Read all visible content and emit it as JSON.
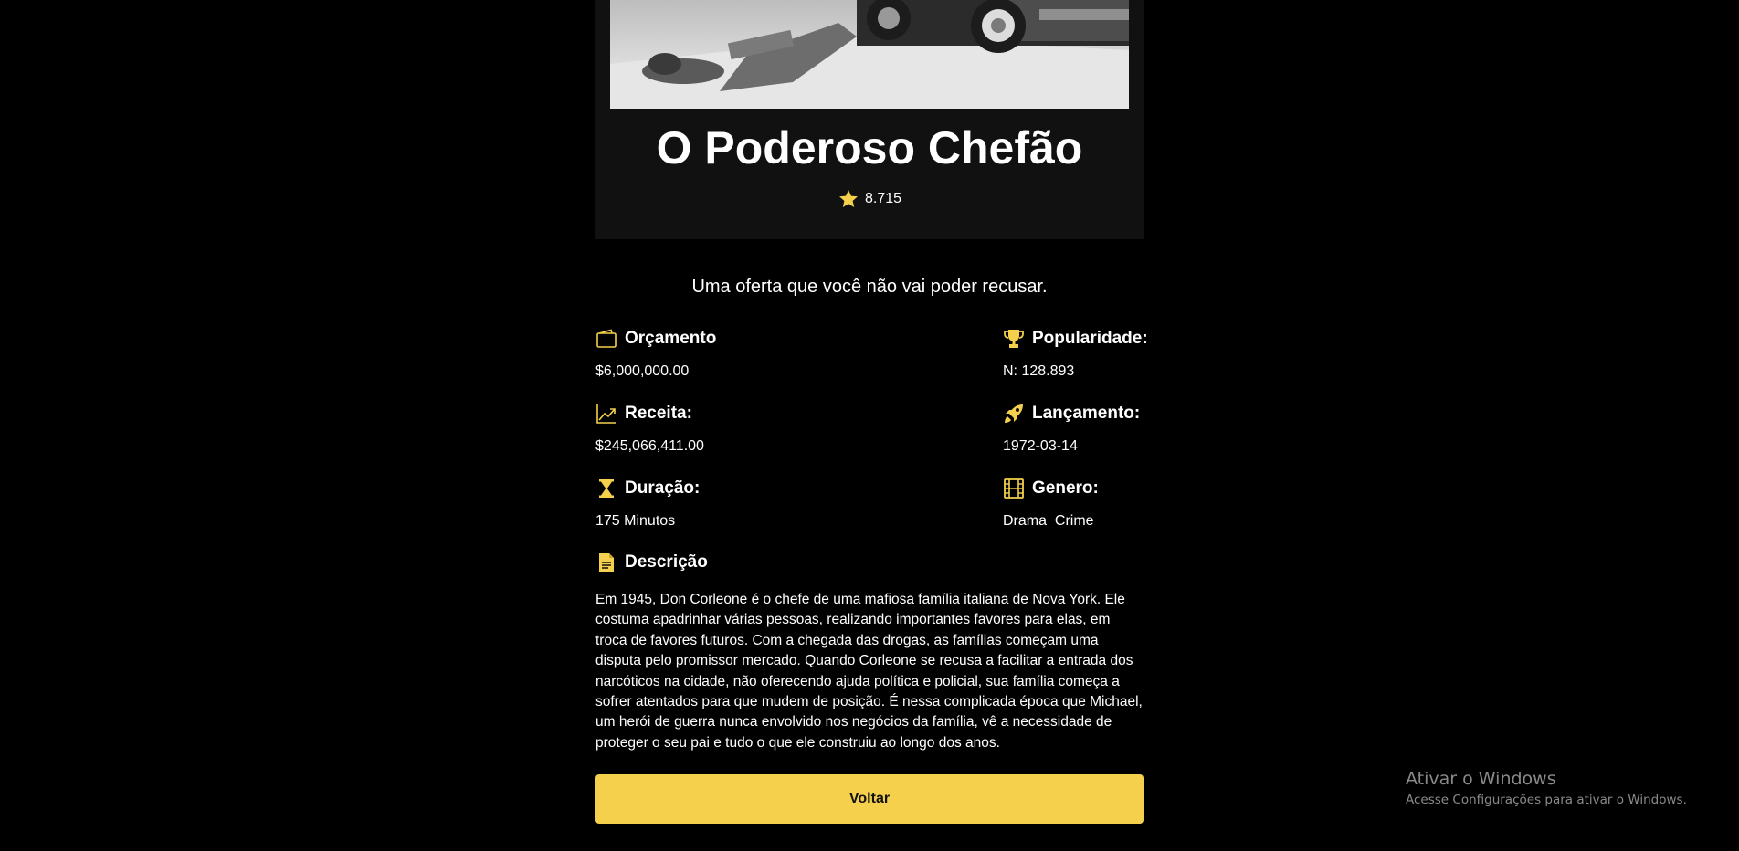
{
  "movie": {
    "title": "O Poderoso Chefão",
    "rating": "8.715",
    "tagline": "Uma oferta que você não vai poder recusar."
  },
  "details": {
    "budget": {
      "label": "Orçamento",
      "value": "$6,000,000.00",
      "icon": "wallet-icon"
    },
    "popularity": {
      "label": "Popularidade:",
      "value": "N: 128.893",
      "icon": "trophy-icon"
    },
    "revenue": {
      "label": "Receita:",
      "value": "$245,066,411.00",
      "icon": "chart-line-icon"
    },
    "release": {
      "label": "Lançamento:",
      "value": "1972-03-14",
      "icon": "rocket-icon"
    },
    "duration": {
      "label": "Duração:",
      "value": "175 Minutos",
      "icon": "hourglass-icon"
    },
    "genre": {
      "label": "Genero:",
      "value": "Drama  Crime",
      "icon": "film-icon"
    }
  },
  "description": {
    "label": "Descrição",
    "icon": "document-icon",
    "text": "Em 1945, Don Corleone é o chefe de uma mafiosa família italiana de Nova York. Ele costuma apadrinhar várias pessoas, realizando importantes favores para elas, em troca de favores futuros. Com a chegada das drogas, as famílias começam uma disputa pelo promissor mercado. Quando Corleone se recusa a facilitar a entrada dos narcóticos na cidade, não oferecendo ajuda política e policial, sua família começa a sofrer atentados para que mudem de posição. É nessa complicada época que Michael, um herói de guerra nunca envolvido nos negócios da família, vê a necessidade de proteger o seu pai e tudo o que ele construiu ao longo dos anos."
  },
  "actions": {
    "back_label": "Voltar"
  },
  "watermark": {
    "line1": "Ativar o Windows",
    "line2": "Acesse Configurações para ativar o Windows."
  },
  "colors": {
    "accent": "#f5d04c",
    "background": "#000000",
    "card": "#111111"
  }
}
